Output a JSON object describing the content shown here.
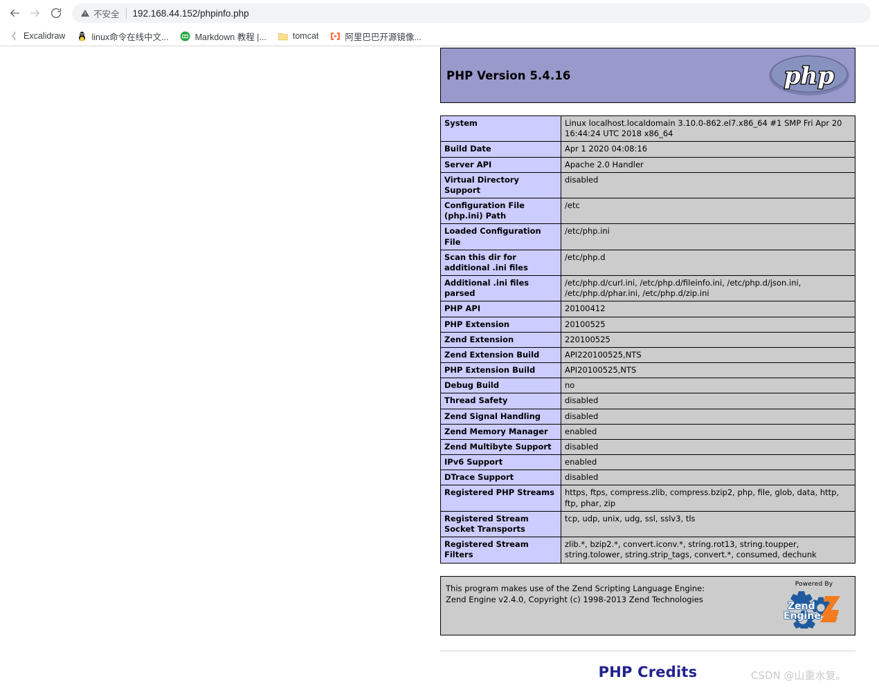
{
  "browser": {
    "nav": {
      "back_icon": "arrow-left-icon",
      "forward_icon": "arrow-right-icon",
      "reload_icon": "reload-icon"
    },
    "omnibox": {
      "security_icon": "warning-triangle-icon",
      "security_label": "不安全",
      "url": "192.168.44.152/phpinfo.php"
    },
    "bookmarks": [
      {
        "label": "Excalidraw",
        "icon": "excalidraw-icon",
        "glyph": "§",
        "color": "#888888"
      },
      {
        "label": "linux命令在线中文...",
        "icon": "tux-penguin-icon",
        "glyph": "🐧",
        "color": "#2b2b2b"
      },
      {
        "label": "Markdown 教程 |...",
        "icon": "markdown-icon",
        "glyph": "M",
        "color": "#2aa745"
      },
      {
        "label": "tomcat",
        "icon": "folder-icon",
        "glyph": "■",
        "color": "#f5d76e"
      },
      {
        "label": "阿里巴巴开源镜像...",
        "icon": "aliyun-bracket-icon",
        "glyph": "[-]",
        "color": "#ff5722"
      }
    ]
  },
  "phpinfo": {
    "version_title": "PHP Version 5.4.16",
    "logo_alt": "php-logo",
    "table": [
      {
        "label": "System",
        "value": "Linux localhost.localdomain 3.10.0-862.el7.x86_64 #1 SMP Fri Apr 20 16:44:24 UTC 2018 x86_64"
      },
      {
        "label": "Build Date",
        "value": "Apr 1 2020 04:08:16"
      },
      {
        "label": "Server API",
        "value": "Apache 2.0 Handler"
      },
      {
        "label": "Virtual Directory Support",
        "value": "disabled"
      },
      {
        "label": "Configuration File (php.ini) Path",
        "value": "/etc"
      },
      {
        "label": "Loaded Configuration File",
        "value": "/etc/php.ini"
      },
      {
        "label": "Scan this dir for additional .ini files",
        "value": "/etc/php.d"
      },
      {
        "label": "Additional .ini files parsed",
        "value": "/etc/php.d/curl.ini, /etc/php.d/fileinfo.ini, /etc/php.d/json.ini, /etc/php.d/phar.ini, /etc/php.d/zip.ini"
      },
      {
        "label": "PHP API",
        "value": "20100412"
      },
      {
        "label": "PHP Extension",
        "value": "20100525"
      },
      {
        "label": "Zend Extension",
        "value": "220100525"
      },
      {
        "label": "Zend Extension Build",
        "value": "API220100525,NTS"
      },
      {
        "label": "PHP Extension Build",
        "value": "API20100525,NTS"
      },
      {
        "label": "Debug Build",
        "value": "no"
      },
      {
        "label": "Thread Safety",
        "value": "disabled"
      },
      {
        "label": "Zend Signal Handling",
        "value": "disabled"
      },
      {
        "label": "Zend Memory Manager",
        "value": "enabled"
      },
      {
        "label": "Zend Multibyte Support",
        "value": "disabled"
      },
      {
        "label": "IPv6 Support",
        "value": "enabled"
      },
      {
        "label": "DTrace Support",
        "value": "disabled"
      },
      {
        "label": "Registered PHP Streams",
        "value": "https, ftps, compress.zlib, compress.bzip2, php, file, glob, data, http, ftp, phar, zip"
      },
      {
        "label": "Registered Stream Socket Transports",
        "value": "tcp, udp, unix, udg, ssl, sslv3, tls"
      },
      {
        "label": "Registered Stream Filters",
        "value": "zlib.*, bzip2.*, convert.iconv.*, string.rot13, string.toupper, string.tolower, string.strip_tags, convert.*, consumed, dechunk"
      }
    ],
    "zend": {
      "line1": "This program makes use of the Zend Scripting Language Engine:",
      "line2": "Zend Engine v2.4.0, Copyright (c) 1998-2013 Zend Technologies",
      "powered_by": "Powered By",
      "logo_alt": "zend-engine-2-logo"
    },
    "credits_title": "PHP Credits"
  },
  "watermark": "CSDN @山重水复。",
  "colors": {
    "header_banner": "#9999cc",
    "label_cell": "#ccccff",
    "value_cell": "#cccccc",
    "credits_title": "#22228f"
  }
}
